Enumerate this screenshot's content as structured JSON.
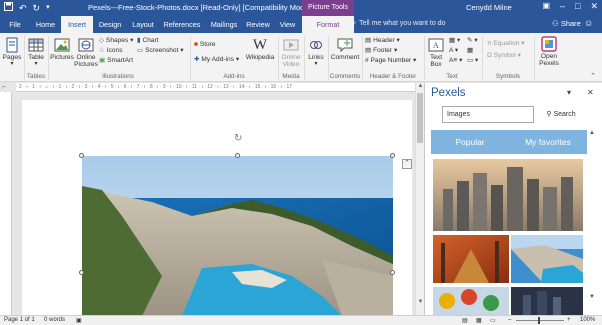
{
  "titlebar": {
    "qat_icons": [
      "save-icon",
      "undo-icon",
      "redo-icon",
      "customize-icon"
    ],
    "title": "Pexels---Free-Stock-Photos.docx [Read-Only] [Compatibility Mode] - Word",
    "context_label": "Picture Tools",
    "user": "Cenydd Milne"
  },
  "tabs": [
    {
      "label": "File"
    },
    {
      "label": "Home"
    },
    {
      "label": "Insert"
    },
    {
      "label": "Design"
    },
    {
      "label": "Layout"
    },
    {
      "label": "References"
    },
    {
      "label": "Mailings"
    },
    {
      "label": "Review"
    },
    {
      "label": "View"
    },
    {
      "label": "Format"
    }
  ],
  "tell_me": "Tell me what you want to do",
  "share": "Share",
  "ribbon": {
    "pages": "Pages",
    "table": "Table",
    "pictures": "Pictures",
    "online_pictures": "Online Pictures",
    "shapes": "Shapes",
    "icons": "Icons",
    "smartart": "SmartArt",
    "chart": "Chart",
    "screenshot": "Screenshot",
    "store": "Store",
    "my_addins": "My Add-ins",
    "wikipedia": "Wikipedia",
    "online_video": "Online Video",
    "links": "Links",
    "comment": "Comment",
    "header": "Header",
    "footer": "Footer",
    "page_number": "Page Number",
    "text_box": "Text Box",
    "equation": "Equation",
    "symbol": "Symbol",
    "open_pexels": "Open Pexels",
    "groups": {
      "tables": "Tables",
      "illustrations": "Illustrations",
      "addins": "Add-ins",
      "media": "Media",
      "comments": "Comments",
      "header_footer": "Header & Footer",
      "text": "Text",
      "symbols": "Symbols"
    }
  },
  "ruler_marks": "· 2 · ı · 1 · ı · ⌂ · ı · 1 · ı · 2 · ı · 3 · ı · 4 · ı · 5 · ı · 6 · ı · 7 · ı · 8 · ı · 9 · ı · 10 · ı · 11 · ı · 12 · ı · 13 · ı · 14 · ı · 15 · ı · 16 · ı · 17",
  "pane": {
    "title": "Pexels",
    "search_value": "Images",
    "search_button": "Search",
    "tab_popular": "Popular",
    "tab_favorites": "My favorites"
  },
  "status": {
    "page": "Page 1 of 1",
    "words": "0 words",
    "zoom": "100%"
  },
  "colors": {
    "brand": "#2b579a",
    "picture_tools": "#7b3f8e",
    "pane_tabs": "#7fb4e0"
  }
}
